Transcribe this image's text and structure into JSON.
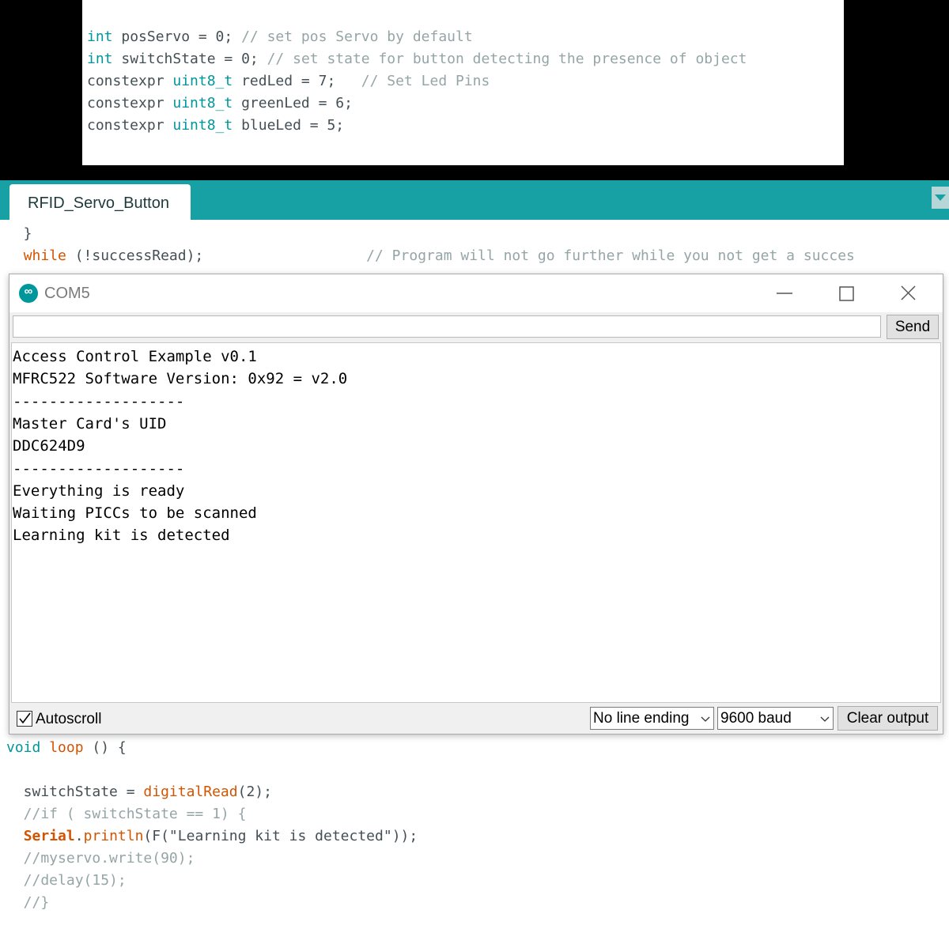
{
  "top_snippet": {
    "lines": [
      [
        {
          "t": "int",
          "c": "kw-teal"
        },
        {
          "t": " posServo = 0; ",
          "c": "plain"
        },
        {
          "t": "// set pos Servo by default",
          "c": "comment"
        }
      ],
      [
        {
          "t": "int",
          "c": "kw-teal"
        },
        {
          "t": " switchState = 0; ",
          "c": "plain"
        },
        {
          "t": "// set state for button detecting the presence of object",
          "c": "comment"
        }
      ],
      [
        {
          "t": "constexpr ",
          "c": "plain"
        },
        {
          "t": "uint8_t",
          "c": "kw-teal"
        },
        {
          "t": " redLed = 7;   ",
          "c": "plain"
        },
        {
          "t": "// Set Led Pins",
          "c": "comment"
        }
      ],
      [
        {
          "t": "constexpr ",
          "c": "plain"
        },
        {
          "t": "uint8_t",
          "c": "kw-teal"
        },
        {
          "t": " greenLed = 6;",
          "c": "plain"
        }
      ],
      [
        {
          "t": "constexpr ",
          "c": "plain"
        },
        {
          "t": "uint8_t",
          "c": "kw-teal"
        },
        {
          "t": " blueLed = 5;",
          "c": "plain"
        }
      ]
    ]
  },
  "tab": {
    "label": "RFID_Servo_Button"
  },
  "editor": {
    "upper_lines": [
      [
        {
          "t": "  }",
          "c": "plain"
        }
      ],
      [
        {
          "t": "  ",
          "c": "plain"
        },
        {
          "t": "while",
          "c": "kw-orange"
        },
        {
          "t": " (!successRead);                   ",
          "c": "plain"
        },
        {
          "t": "// Program will not go further while you not get a succes",
          "c": "comment"
        }
      ]
    ],
    "lower_lines": [
      [
        {
          "t": "void",
          "c": "kw-teal"
        },
        {
          "t": " ",
          "c": "plain"
        },
        {
          "t": "loop",
          "c": "kw-orange"
        },
        {
          "t": " () {",
          "c": "plain"
        }
      ],
      [
        {
          "t": "",
          "c": "plain"
        }
      ],
      [
        {
          "t": "  switchState = ",
          "c": "plain"
        },
        {
          "t": "digitalRead",
          "c": "kw-orange"
        },
        {
          "t": "(2);",
          "c": "plain"
        }
      ],
      [
        {
          "t": "  //if ( switchState == 1) {",
          "c": "comment"
        }
      ],
      [
        {
          "t": "  ",
          "c": "plain"
        },
        {
          "t": "Serial",
          "c": "kw-bold-orange"
        },
        {
          "t": ".",
          "c": "plain"
        },
        {
          "t": "println",
          "c": "kw-orange"
        },
        {
          "t": "(F(\"Learning kit is detected\"));",
          "c": "plain"
        }
      ],
      [
        {
          "t": "  //myservo.write(90);",
          "c": "comment"
        }
      ],
      [
        {
          "t": "  //delay(15);",
          "c": "comment"
        }
      ],
      [
        {
          "t": "  //}",
          "c": "comment"
        }
      ]
    ]
  },
  "serial_monitor": {
    "title": "COM5",
    "logo_glyph": "∞",
    "send_label": "Send",
    "input_value": "",
    "output_lines": [
      "Access Control Example v0.1",
      "MFRC522 Software Version: 0x92 = v2.0",
      "-------------------",
      "Master Card's UID",
      "DDC624D9",
      "-------------------",
      "Everything is ready",
      "Waiting PICCs to be scanned",
      "Learning kit is detected"
    ],
    "autoscroll_label": "Autoscroll",
    "autoscroll_checked": true,
    "line_ending": "No line ending",
    "baud": "9600 baud",
    "clear_label": "Clear output"
  },
  "colors": {
    "tab_bar": "#17a1a5",
    "keyword_teal": "#00979c",
    "keyword_orange": "#d35400",
    "comment": "#95a5a6"
  }
}
